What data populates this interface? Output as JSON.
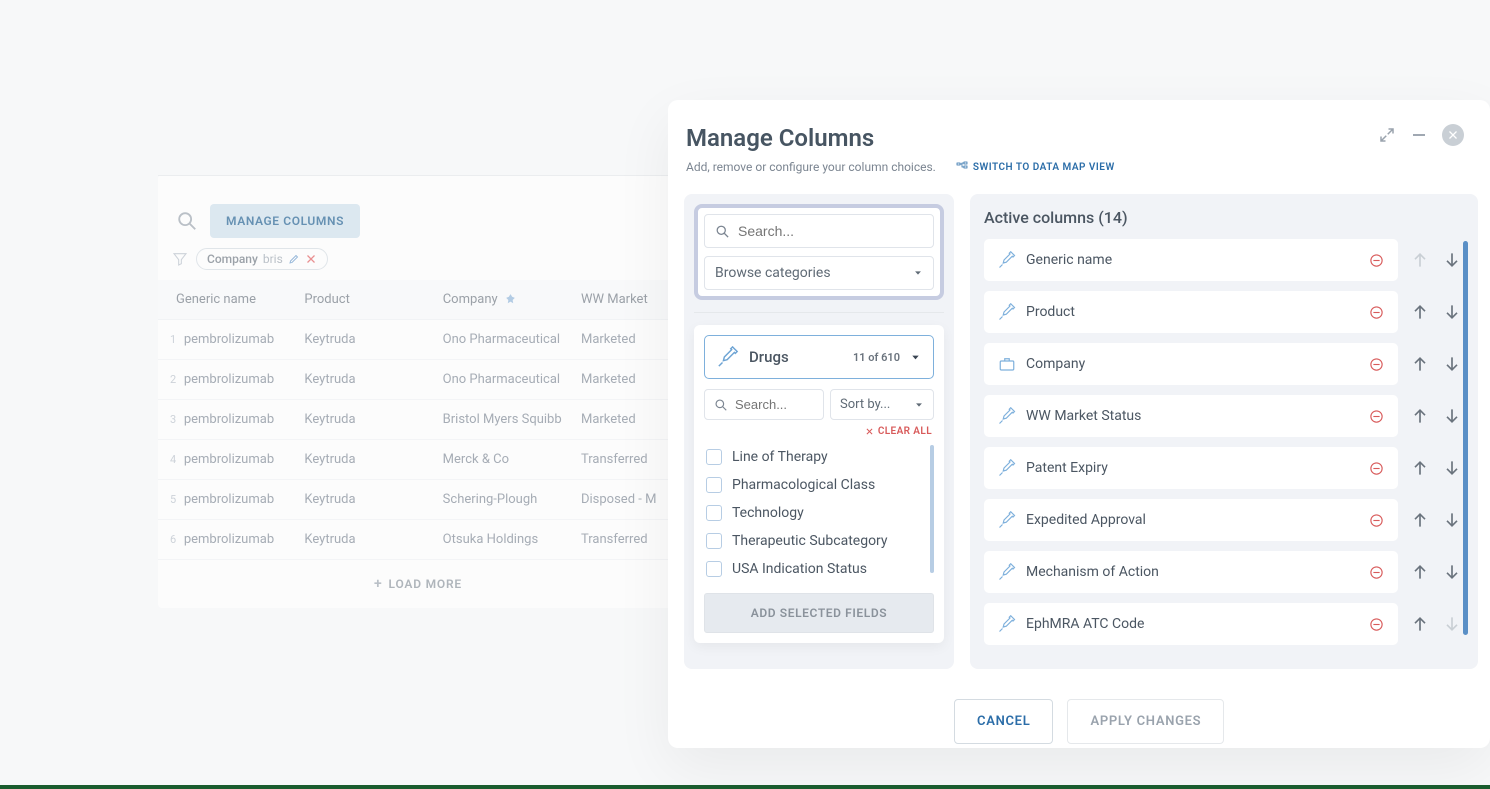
{
  "toolbar": {
    "manage_columns_label": "MANAGE COLUMNS"
  },
  "filter": {
    "label": "Company",
    "value": "bris"
  },
  "table": {
    "headers": {
      "generic": "Generic name",
      "product": "Product",
      "company": "Company",
      "ww": "WW Market"
    },
    "rows": [
      {
        "generic": "pembrolizumab",
        "product": "Keytruda",
        "company": "Ono Pharmaceutical",
        "ww": "Marketed"
      },
      {
        "generic": "pembrolizumab",
        "product": "Keytruda",
        "company": "Ono Pharmaceutical",
        "ww": "Marketed"
      },
      {
        "generic": "pembrolizumab",
        "product": "Keytruda",
        "company": "Bristol Myers Squibb",
        "ww": "Marketed"
      },
      {
        "generic": "pembrolizumab",
        "product": "Keytruda",
        "company": "Merck & Co",
        "ww": "Transferred"
      },
      {
        "generic": "pembrolizumab",
        "product": "Keytruda",
        "company": "Schering-Plough",
        "ww": "Disposed - M"
      },
      {
        "generic": "pembrolizumab",
        "product": "Keytruda",
        "company": "Otsuka Holdings",
        "ww": "Transferred"
      }
    ],
    "load_more": "LOAD MORE"
  },
  "modal": {
    "title": "Manage Columns",
    "subtitle": "Add, remove or configure your column choices.",
    "switch_link": "SWITCH TO DATA MAP VIEW",
    "left": {
      "search_placeholder": "Search...",
      "browse_label": "Browse categories",
      "category": {
        "name": "Drugs",
        "count": "11 of 610",
        "search_placeholder": "Search...",
        "sort_label": "Sort by...",
        "clear_all": "CLEAR ALL"
      },
      "fields": [
        "Line of Therapy",
        "Pharmacological Class",
        "Technology",
        "Therapeutic Subcategory",
        "USA Indication Status"
      ],
      "add_button": "ADD SELECTED FIELDS"
    },
    "right": {
      "title": "Active columns (14)",
      "columns": [
        {
          "name": "Generic name",
          "icon": "syringe",
          "up_disabled": true,
          "down_disabled": false
        },
        {
          "name": "Product",
          "icon": "syringe",
          "up_disabled": false,
          "down_disabled": false
        },
        {
          "name": "Company",
          "icon": "briefcase",
          "up_disabled": false,
          "down_disabled": false
        },
        {
          "name": "WW Market Status",
          "icon": "syringe",
          "up_disabled": false,
          "down_disabled": false
        },
        {
          "name": "Patent Expiry",
          "icon": "syringe",
          "up_disabled": false,
          "down_disabled": false
        },
        {
          "name": "Expedited Approval",
          "icon": "syringe",
          "up_disabled": false,
          "down_disabled": false
        },
        {
          "name": "Mechanism of Action",
          "icon": "syringe",
          "up_disabled": false,
          "down_disabled": false
        },
        {
          "name": "EphMRA ATC Code",
          "icon": "syringe",
          "up_disabled": false,
          "down_disabled": true
        }
      ]
    },
    "footer": {
      "cancel": "CANCEL",
      "apply": "APPLY CHANGES"
    }
  }
}
